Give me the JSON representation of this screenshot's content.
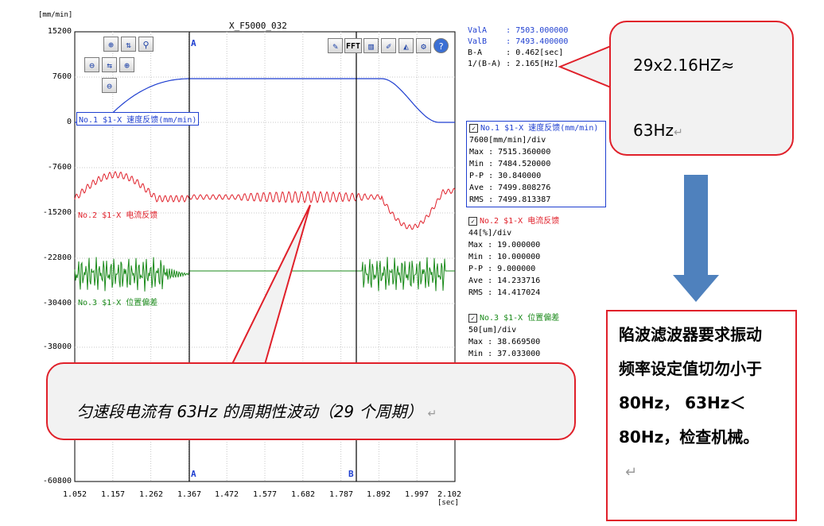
{
  "window": {
    "title": "X_F5000_032",
    "y_unit": "[mm/min]",
    "x_unit": "[sec]"
  },
  "axes": {
    "y_ticks": [
      "15200",
      "7600",
      "0",
      "-7600",
      "-15200",
      "-22800",
      "-30400",
      "-38000",
      "-60800"
    ],
    "x_ticks": [
      "1.052",
      "1.157",
      "1.262",
      "1.367",
      "1.472",
      "1.577",
      "1.682",
      "1.787",
      "1.892",
      "1.997",
      "2.102"
    ]
  },
  "cursors": {
    "a_label": "A",
    "b_label": "B"
  },
  "toolbar": {
    "fft_label": "FFT",
    "icons": [
      "zoom-in-x-icon",
      "fit-y-icon",
      "zoom-y-icon",
      "zoom-out-icon",
      "swap-icon",
      "zoom-box-icon",
      "zoom-region-icon",
      "export-icon",
      "fft-icon",
      "bar-chart-icon",
      "marker-icon",
      "area-chart-icon",
      "settings-icon",
      "help-icon"
    ]
  },
  "legend": {
    "ch1": "No.1 $1-X 速度反馈(mm/min)",
    "ch2": "No.2 $1-X 电流反馈",
    "ch3": "No.3 $1-X 位置偏差"
  },
  "readout": [
    "ValA    : 7503.000000",
    "ValB    : 7493.400000",
    "B-A     : 0.462[sec]",
    "1/(B-A) : 2.165[Hz]"
  ],
  "channels": [
    {
      "title": "No.1 $1-X 速度反馈(mm/min)",
      "color": "#1f3fd0",
      "lines": [
        "7600[mm/min]/div",
        "Max  : 7515.360000",
        "Min  : 7484.520000",
        "P-P  : 30.840000",
        "Ave  : 7499.808276",
        "RMS  : 7499.813387"
      ]
    },
    {
      "title": "No.2 $1-X 电流反馈",
      "color": "#e0202a",
      "lines": [
        "44[%]/div",
        "Max  : 19.000000",
        "Min  : 10.000000",
        "P-P  : 9.000000",
        "Ave  : 14.233716",
        "RMS  : 14.417024"
      ]
    },
    {
      "title": "No.3 $1-X 位置偏差",
      "color": "#1a8a1a",
      "lines": [
        "50[um]/div",
        "Max  : 38.669500",
        "Min  : 37.033000"
      ]
    }
  ],
  "callouts": {
    "freq_line1": "29x2.16HZ≈",
    "freq_line2": "63Hz",
    "current_note": "匀速段电流有 63Hz 的周期性波动（29 个周期）",
    "notch_text": "陷波滤波器要求振动频率设定值切勿小于80Hz， 63Hz＜80Hz，检查机械。",
    "return_mark": "↵"
  },
  "colors": {
    "speed": "#1f3fd0",
    "current": "#e0202a",
    "position": "#1a8a1a",
    "callout_border": "#e0202a",
    "arrow": "#4f81bd"
  }
}
